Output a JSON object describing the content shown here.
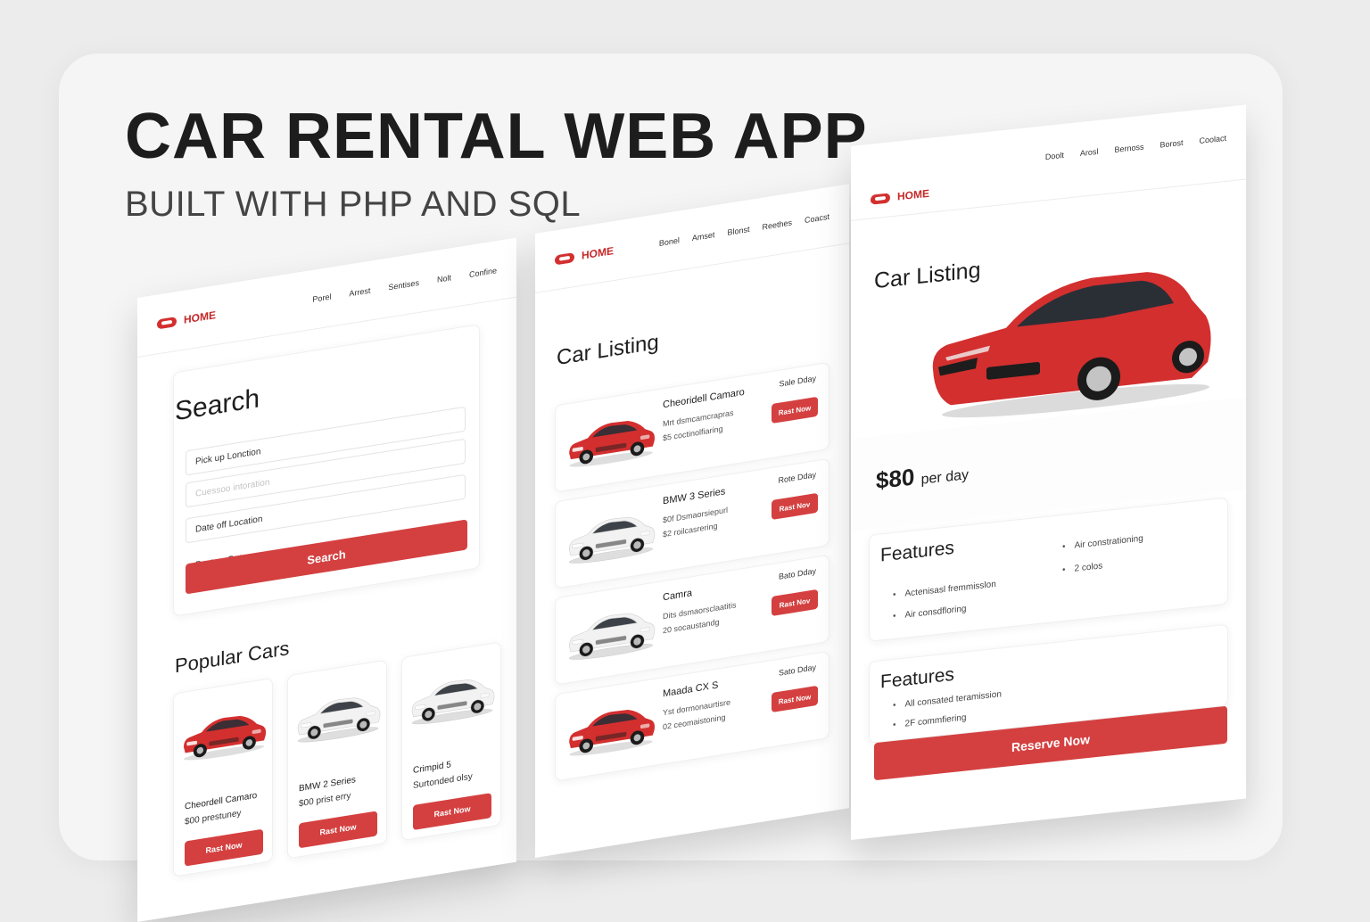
{
  "hero": {
    "title": "CAR RENTAL WEB APP",
    "subtitle": "BUILT WITH PHP AND SQL"
  },
  "colors": {
    "accent": "#d44040",
    "background": "#f5f5f5",
    "car_red": "#d32f2f",
    "car_white": "#f2f2f2"
  },
  "search_screen": {
    "brand": "HOME",
    "nav": [
      "Porel",
      "Arrest",
      "Sentises",
      "Nolt",
      "Confine"
    ],
    "search": {
      "title": "Search",
      "pickup_location": "Pick up Lonction",
      "placeholder": "Cuessoo intoration",
      "dropoff_location": "Date off Location",
      "pickup_date": "Pest up Date",
      "button": "Search"
    },
    "popular": {
      "title": "Popular Cars",
      "cars": [
        {
          "name": "Cheordell Camaro",
          "price": "$00 prestuney",
          "button": "Rast Now",
          "color": "red"
        },
        {
          "name": "BMW 2 Series",
          "price": "$00 prist erry",
          "button": "Rast Now",
          "color": "white"
        },
        {
          "name": "Crimpid 5",
          "price": "Surtonded olsy",
          "button": "Rast Now",
          "color": "white"
        }
      ]
    }
  },
  "listing_screen": {
    "brand": "HOME",
    "nav": [
      "Bonel",
      "Amset",
      "Blonst",
      "Reethes",
      "Coacst"
    ],
    "title": "Car Listing",
    "items": [
      {
        "name": "Cheoridell Camaro",
        "meta1": "Mrt dsmcamcrapras",
        "meta2": "$5 coctinolfiaring",
        "rate": "Sale Dday",
        "button": "Rast Now",
        "color": "red"
      },
      {
        "name": "BMW 3 Series",
        "meta1": "$0f Dsmaorsiepurl",
        "meta2": "$2 roilcasrering",
        "rate": "Rote Dday",
        "button": "Rast Nov",
        "color": "white"
      },
      {
        "name": "Camra",
        "meta1": "Dits dsmaorsclaatitis",
        "meta2": "20 socaustandg",
        "rate": "Bato Dday",
        "button": "Rast Nov",
        "color": "white"
      },
      {
        "name": "Maada CX S",
        "meta1": "Yst dormonaurtisre",
        "meta2": "02 ceomaistoning",
        "rate": "Sato Dday",
        "button": "Rast Now",
        "color": "red"
      }
    ]
  },
  "detail_screen": {
    "brand": "HOME",
    "nav": [
      "Doolt",
      "Arosl",
      "Bernoss",
      "Borost",
      "Coolact"
    ],
    "title": "Car Listing",
    "price": "$80",
    "price_unit": "per day",
    "features1": {
      "title": "Features",
      "left": [
        "Actenisasl fremmisslon",
        "Air consdfloring"
      ],
      "right": [
        "Air constrationing",
        "2 colos"
      ]
    },
    "features2": {
      "title": "Features",
      "items": [
        "All consated teramission",
        "2F commfiering"
      ]
    },
    "button": "Reserve Now"
  }
}
